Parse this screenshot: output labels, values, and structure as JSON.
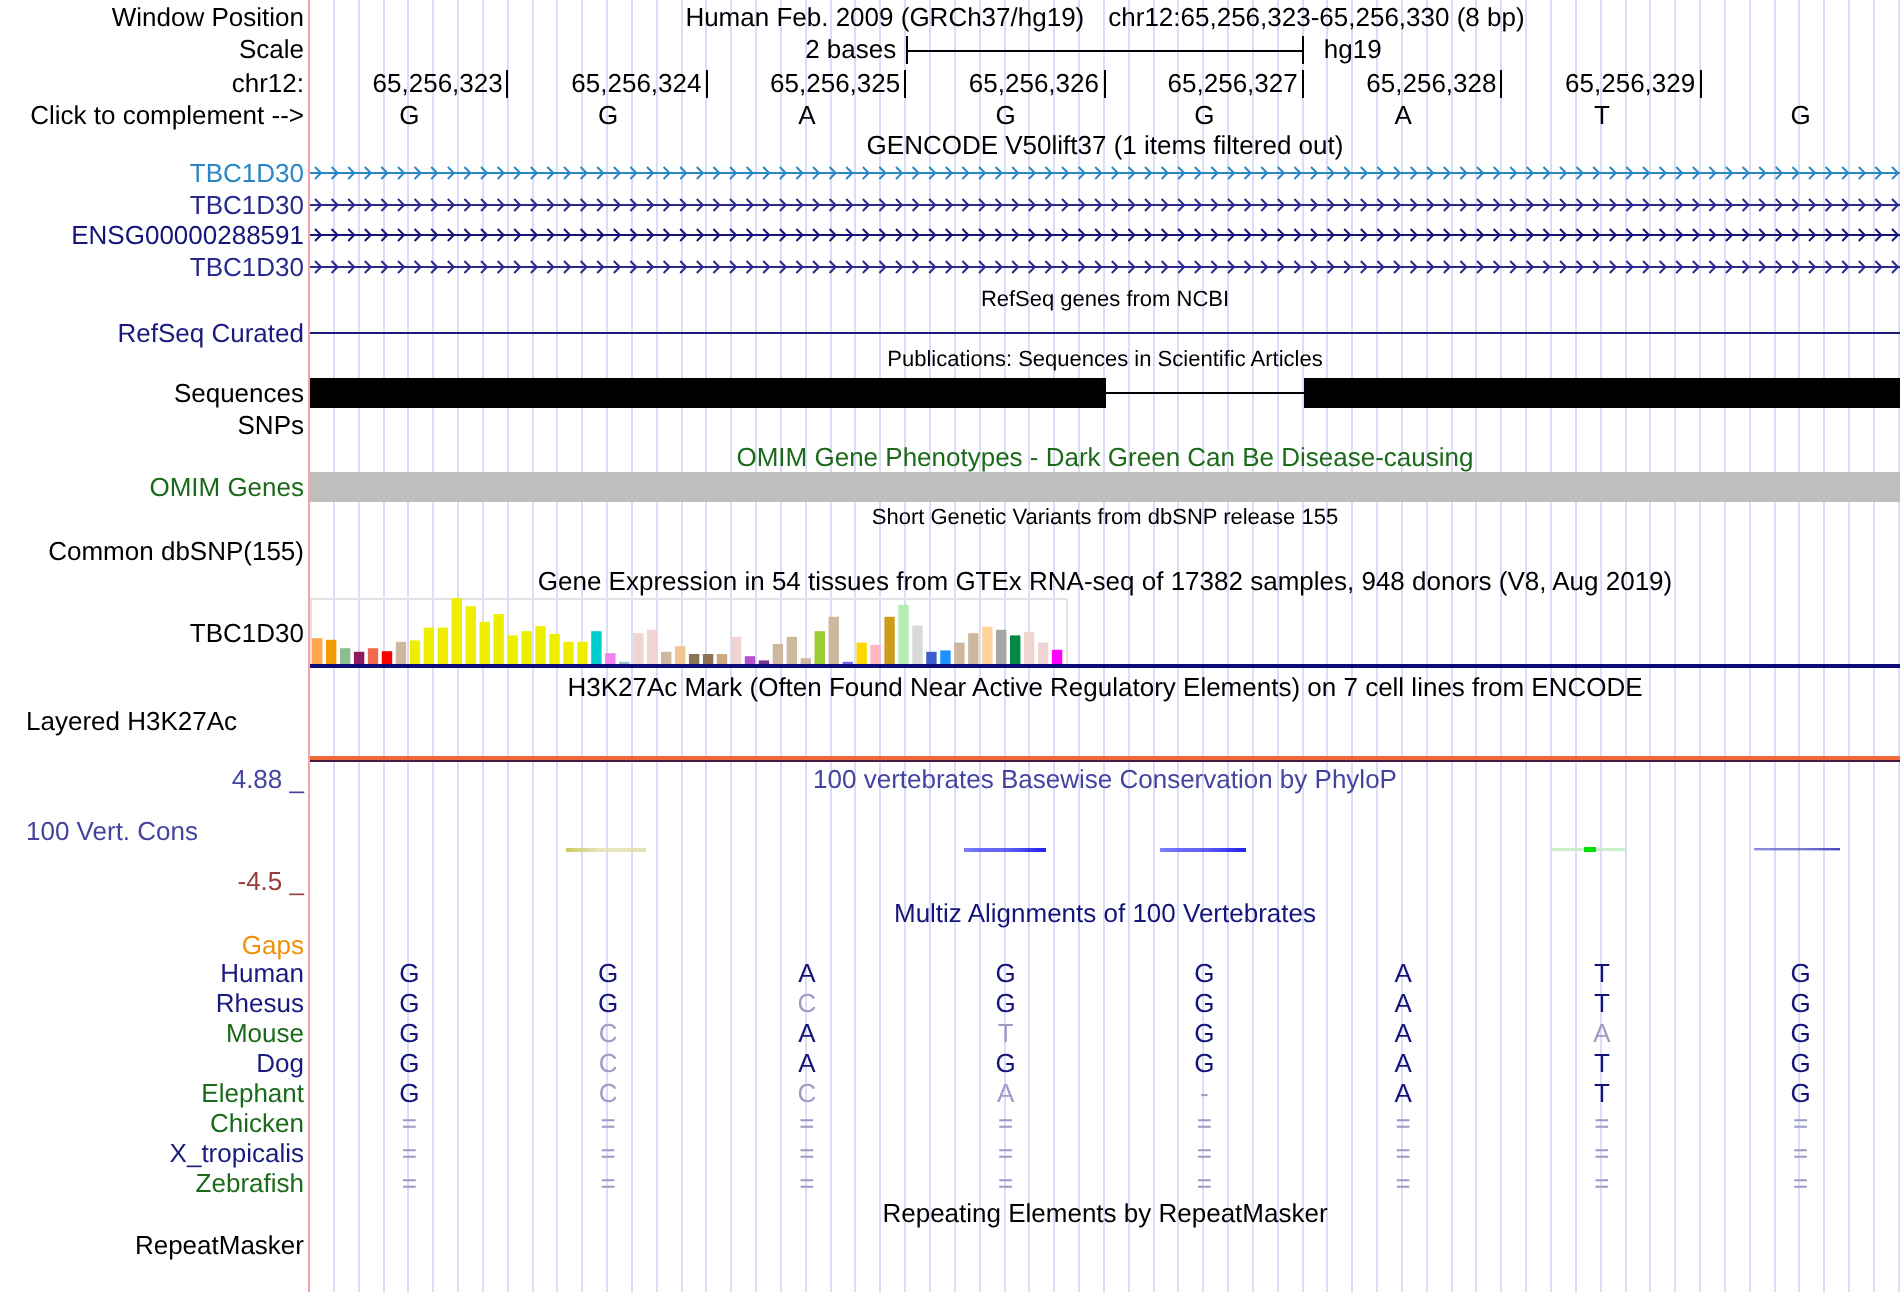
{
  "position_header": {
    "label": "Window Position",
    "assembly": "Human Feb. 2009 (GRCh37/hg19)",
    "range": "chr12:65,256,323-65,256,330 (8 bp)"
  },
  "scale": {
    "label": "Scale",
    "length": "2 bases",
    "database": "hg19"
  },
  "ruler": {
    "label": "chr12:",
    "ticks": [
      "65,256,323",
      "65,256,324",
      "65,256,325",
      "65,256,326",
      "65,256,327",
      "65,256,328",
      "65,256,329"
    ]
  },
  "sequence": {
    "link": "Click to complement -->",
    "bases": [
      "G",
      "G",
      "A",
      "G",
      "G",
      "A",
      "T",
      "G"
    ]
  },
  "tracks": [
    {
      "kind": "genes",
      "title": {
        "text": "GENCODE V50lift37 (1 items filtered out)"
      },
      "items": [
        {
          "label": "TBC1D30",
          "color": "#2b86c5"
        },
        {
          "label": "TBC1D30",
          "color": "#2a2a8e"
        },
        {
          "label": "ENSG00000288591",
          "color": "#14147a"
        },
        {
          "label": "TBC1D30",
          "color": "#2a2a8e"
        }
      ]
    },
    {
      "kind": "line",
      "title": {
        "text": "RefSeq genes from NCBI"
      },
      "label": "RefSeq Curated",
      "color": "#1a1a7e"
    },
    {
      "kind": "publications",
      "title": {
        "text": "Publications: Sequences in Scientific Articles"
      },
      "labels": [
        "Sequences",
        "SNPs"
      ]
    },
    {
      "kind": "omim",
      "title": {
        "text": "OMIM Gene Phenotypes - Dark Green Can Be Disease-causing",
        "color": "#1a6a1a"
      },
      "label": "OMIM Genes",
      "color": "#1a6a1a"
    },
    {
      "kind": "snps",
      "title": {
        "text": "Short Genetic Variants from dbSNP release 155"
      },
      "label": "Common dbSNP(155)"
    },
    {
      "kind": "expression",
      "title": {
        "text": "Gene Expression in 54 tissues from GTEx RNA-seq of 17382 samples, 948 donors (V8, Aug 2019)"
      },
      "label": "TBC1D30"
    },
    {
      "kind": "layered",
      "title": {
        "text": "H3K27Ac Mark (Often Found Near Active Regulatory Elements) on 7 cell lines from ENCODE"
      },
      "label": "Layered H3K27Ac"
    },
    {
      "kind": "wiggle",
      "title": {
        "text": "100 vertebrates Basewise Conservation by PhyloP",
        "color": "#4444a0"
      },
      "label": "100 Vert. Cons",
      "color": "#4444a0",
      "max": {
        "text": "4.88 _",
        "color": "#4444a0"
      },
      "min": {
        "text": "-4.5 _",
        "color": "#9a3c3c"
      }
    },
    {
      "kind": "multiz",
      "title": {
        "text": "Multiz Alignments of 100 Vertebrates",
        "color": "#14147a"
      },
      "gaps": {
        "label": "Gaps",
        "color": "#f0900a"
      },
      "species": [
        {
          "name": "Human",
          "color": "#1a1a7e",
          "bases": [
            {
              "base": "G",
              "match": true
            },
            {
              "base": "G",
              "match": true
            },
            {
              "base": "A",
              "match": true
            },
            {
              "base": "G",
              "match": true
            },
            {
              "base": "G",
              "match": true
            },
            {
              "base": "A",
              "match": true
            },
            {
              "base": "T",
              "match": true
            },
            {
              "base": "G",
              "match": true
            }
          ]
        },
        {
          "name": "Rhesus",
          "color": "#1a1a7e",
          "bases": [
            {
              "base": "G",
              "match": true
            },
            {
              "base": "G",
              "match": true
            },
            {
              "base": "C",
              "match": false
            },
            {
              "base": "G",
              "match": true
            },
            {
              "base": "G",
              "match": true
            },
            {
              "base": "A",
              "match": true
            },
            {
              "base": "T",
              "match": true
            },
            {
              "base": "G",
              "match": true
            }
          ]
        },
        {
          "name": "Mouse",
          "color": "#1a6a1a",
          "bases": [
            {
              "base": "G",
              "match": true
            },
            {
              "base": "C",
              "match": false
            },
            {
              "base": "A",
              "match": true
            },
            {
              "base": "T",
              "match": false
            },
            {
              "base": "G",
              "match": true
            },
            {
              "base": "A",
              "match": true
            },
            {
              "base": "A",
              "match": false
            },
            {
              "base": "G",
              "match": true
            }
          ]
        },
        {
          "name": "Dog",
          "color": "#1a1a7e",
          "bases": [
            {
              "base": "G",
              "match": true
            },
            {
              "base": "C",
              "match": false
            },
            {
              "base": "A",
              "match": true
            },
            {
              "base": "G",
              "match": true
            },
            {
              "base": "G",
              "match": true
            },
            {
              "base": "A",
              "match": true
            },
            {
              "base": "T",
              "match": true
            },
            {
              "base": "G",
              "match": true
            }
          ]
        },
        {
          "name": "Elephant",
          "color": "#1a6a1a",
          "bases": [
            {
              "base": "G",
              "match": true
            },
            {
              "base": "C",
              "match": false
            },
            {
              "base": "C",
              "match": false
            },
            {
              "base": "A",
              "match": false
            },
            {
              "base": "-",
              "match": false
            },
            {
              "base": "A",
              "match": true
            },
            {
              "base": "T",
              "match": true
            },
            {
              "base": "G",
              "match": true
            }
          ]
        },
        {
          "name": "Chicken",
          "color": "#1a6a1a",
          "bases": [
            {
              "base": "=",
              "match": false
            },
            {
              "base": "=",
              "match": false
            },
            {
              "base": "=",
              "match": false
            },
            {
              "base": "=",
              "match": false
            },
            {
              "base": "=",
              "match": false
            },
            {
              "base": "=",
              "match": false
            },
            {
              "base": "=",
              "match": false
            },
            {
              "base": "=",
              "match": false
            }
          ]
        },
        {
          "name": "X_tropicalis",
          "color": "#1a1a7e",
          "bases": [
            {
              "base": "=",
              "match": false
            },
            {
              "base": "=",
              "match": false
            },
            {
              "base": "=",
              "match": false
            },
            {
              "base": "=",
              "match": false
            },
            {
              "base": "=",
              "match": false
            },
            {
              "base": "=",
              "match": false
            },
            {
              "base": "=",
              "match": false
            },
            {
              "base": "=",
              "match": false
            }
          ]
        },
        {
          "name": "Zebrafish",
          "color": "#1a6a1a",
          "bases": [
            {
              "base": "=",
              "match": false
            },
            {
              "base": "=",
              "match": false
            },
            {
              "base": "=",
              "match": false
            },
            {
              "base": "=",
              "match": false
            },
            {
              "base": "=",
              "match": false
            },
            {
              "base": "=",
              "match": false
            },
            {
              "base": "=",
              "match": false
            },
            {
              "base": "=",
              "match": false
            }
          ]
        }
      ]
    },
    {
      "kind": "repeats",
      "title": {
        "text": "Repeating Elements by RepeatMasker"
      },
      "label": "RepeatMasker"
    }
  ]
}
